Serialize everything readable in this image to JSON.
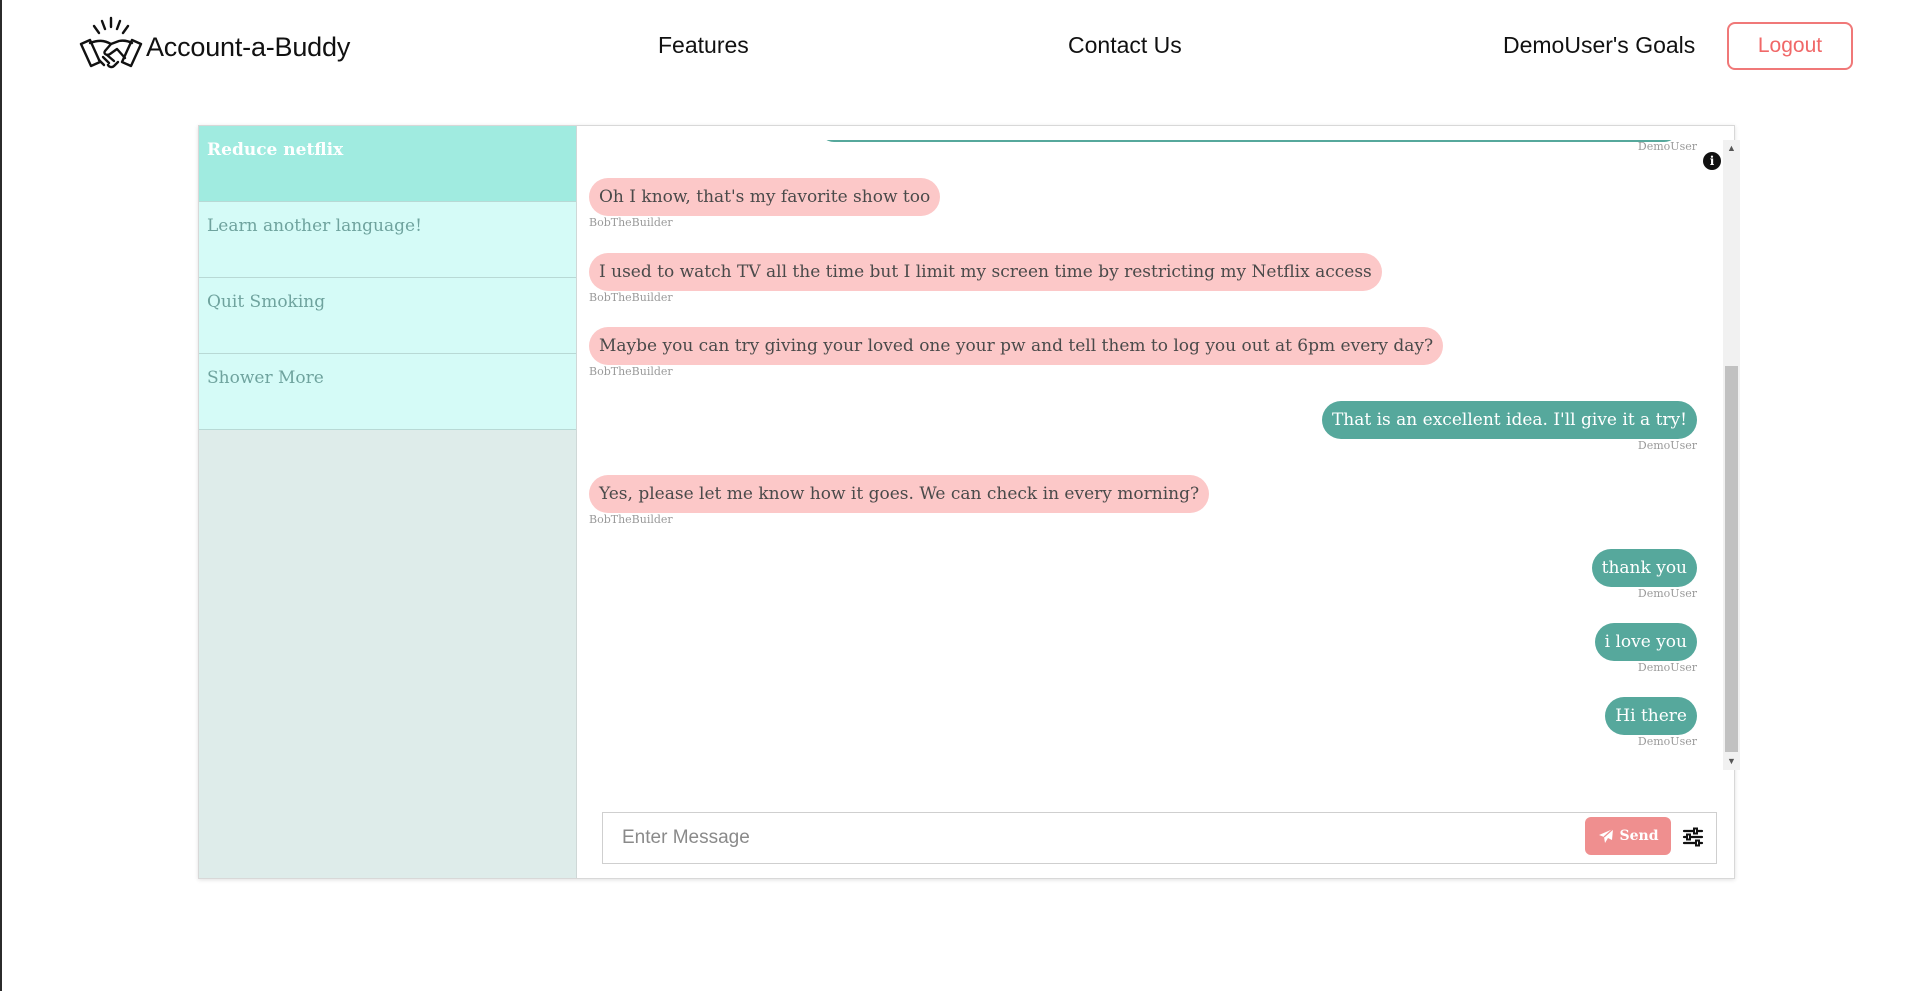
{
  "nav": {
    "brand": "Account-a-Buddy",
    "features": "Features",
    "contact": "Contact Us",
    "goals": "DemoUser's Goals",
    "logout": "Logout"
  },
  "sidebar": {
    "goals": [
      {
        "label": "Reduce netflix",
        "active": true
      },
      {
        "label": "Learn another language!",
        "active": false
      },
      {
        "label": "Quit Smoking",
        "active": false
      },
      {
        "label": "Shower More",
        "active": false
      }
    ]
  },
  "chat": {
    "messages": [
      {
        "text": "Oh I know, that's my favorite show too",
        "sender": "BobTheBuilder"
      },
      {
        "text": "I used to watch TV all the time but I limit my screen time by restricting my Netflix access",
        "sender": "BobTheBuilder"
      },
      {
        "text": "Maybe you can try giving your loved one your pw and tell them to log you out at 6pm every day?",
        "sender": "BobTheBuilder"
      },
      {
        "text": "That is an excellent idea. I'll give it a try!",
        "sender": "DemoUser"
      },
      {
        "text": "Yes, please let me know how it goes. We can check in every morning?",
        "sender": "BobTheBuilder"
      },
      {
        "text": "thank you",
        "sender": "DemoUser"
      },
      {
        "text": "i love you",
        "sender": "DemoUser"
      },
      {
        "text": "Hi there",
        "sender": "DemoUser"
      }
    ],
    "top_sender": "DemoUser",
    "info_icon": "i",
    "input_placeholder": "Enter Message",
    "send_label": "Send"
  },
  "colors": {
    "accent": "#56a89c",
    "incoming_bubble": "#fcc8c8",
    "send_button": "#ef8f8f",
    "logout": "#f06868",
    "active_goal": "#a0ebe0",
    "goal_bg": "#d5fbf7"
  },
  "icons": [
    "handshake-logo",
    "info-icon",
    "paper-plane-icon",
    "sliders-icon",
    "scroll-up-arrow",
    "scroll-down-arrow"
  ]
}
